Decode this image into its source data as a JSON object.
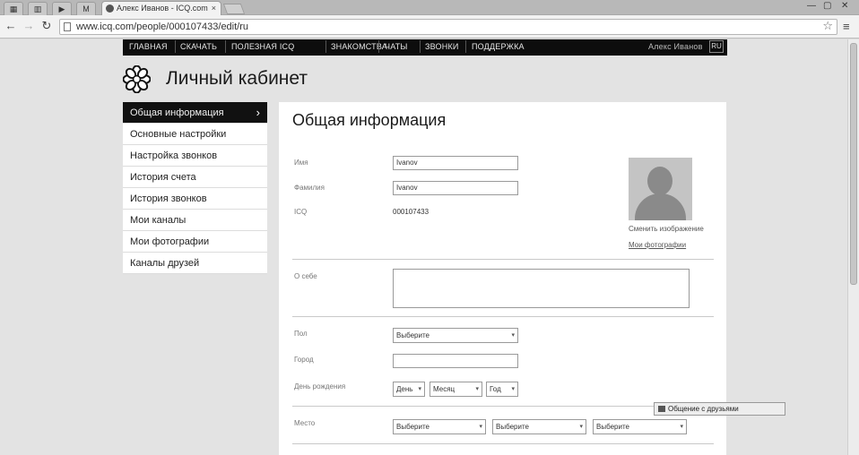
{
  "browser": {
    "small_tabs": [
      "▦",
      "▥",
      "▶",
      "M"
    ],
    "active_tab_title": "Алекс Иванов - ICQ.com",
    "tab_close": "×",
    "url": "www.icq.com/people/000107433/edit/ru",
    "back": "←",
    "forward": "→",
    "reload": "↻",
    "star": "☆",
    "menu": "≡",
    "minimize": "—",
    "maximize": "▢",
    "close": "✕"
  },
  "site_nav": {
    "items": [
      "ГЛАВНАЯ",
      "СКАЧАТЬ",
      "ПОЛЕЗНАЯ ICQ",
      "ЗНАКОМСТВА",
      "ЧАТЫ",
      "ЗВОНКИ",
      "ПОДДЕРЖКА"
    ],
    "user": "Алекс Иванов",
    "lang": "RU"
  },
  "header": {
    "title": "Личный кабинет"
  },
  "sidemenu": {
    "items": [
      {
        "label": "Общая информация",
        "active": true
      },
      {
        "label": "Основные настройки",
        "active": false
      },
      {
        "label": "Настройка звонков",
        "active": false
      },
      {
        "label": "История счета",
        "active": false
      },
      {
        "label": "История звонков",
        "active": false
      },
      {
        "label": "Мои каналы",
        "active": false
      },
      {
        "label": "Мои фотографии",
        "active": false
      },
      {
        "label": "Каналы друзей",
        "active": false
      }
    ],
    "active_chevron": "›"
  },
  "panel": {
    "title": "Общая информация",
    "fields": {
      "name_label": "Имя",
      "name_value": "Ivanov",
      "surname_label": "Фамилия",
      "surname_value": "Ivanov",
      "icq_label": "ICQ",
      "icq_value": "000107433",
      "about_label": "О себе",
      "gender_label": "Пол",
      "gender_value": "Выберите",
      "city_label": "Город",
      "city_value": "",
      "birthday_label": "День рождения",
      "birthday_day": "День",
      "birthday_month": "Месяц",
      "birthday_year": "Год",
      "location_label": "Место",
      "location_country": "Выберите",
      "location_region": "Выберите",
      "location_city": "Выберите"
    },
    "avatar": {
      "change_link": "Сменить изображение",
      "my_photos_link": "Мои фотографии"
    },
    "caret": "▾"
  },
  "chat_bar": {
    "label": "Общение с друзьями"
  }
}
